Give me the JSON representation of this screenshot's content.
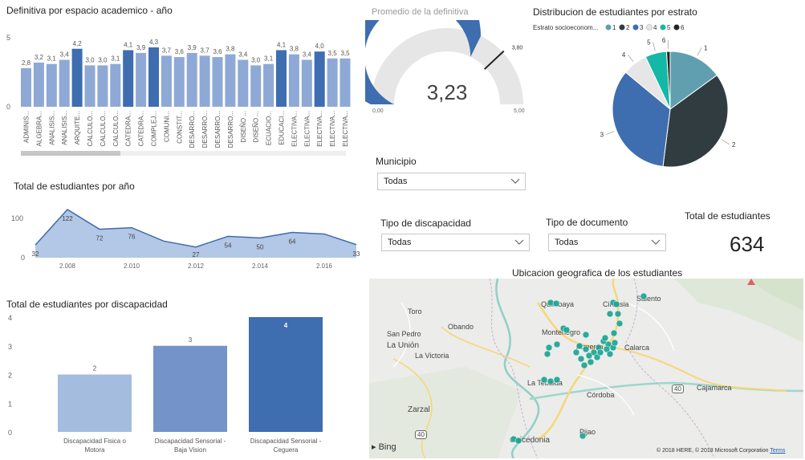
{
  "visual_bar": {
    "title": "Definitiva por espacio academico - año",
    "chart_data": {
      "type": "bar",
      "categories": [
        "ADMINIS...",
        "ALGEBRA...",
        "ANALISIS...",
        "ANALISIS...",
        "ARQUITE...",
        "CALCULO...",
        "CALCULO...",
        "CALCULO...",
        "CATEDRA...",
        "CATEDRA...",
        "COMPLEJ...",
        "COMUNI...",
        "CONSTIT...",
        "DESARRO...",
        "DESARRO...",
        "DESARRO...",
        "DESARRO...",
        "DISEÑO ...",
        "DISEÑO ...",
        "ECUACIO...",
        "EDUCACI...",
        "ELECTIVA...",
        "ELECTIVA...",
        "ELECTIVA...",
        "ELECTIVA...",
        "ELECTIVA..."
      ],
      "values": [
        2.8,
        3.2,
        3.1,
        3.4,
        4.2,
        3.0,
        3.0,
        3.1,
        4.1,
        3.9,
        4.3,
        3.7,
        3.6,
        3.9,
        3.7,
        3.6,
        3.8,
        3.4,
        3.0,
        3.1,
        4.1,
        3.8,
        3.4,
        4.0,
        3.5,
        3.5
      ],
      "value_labels": [
        "2,8",
        "3,2",
        "3,1",
        "3,4",
        "4,2",
        "3,0",
        "3,0",
        "3,1",
        "4,1",
        "3,9",
        "4,3",
        "3,7",
        "3,6",
        "3,9",
        "3,7",
        "3,6",
        "3,8",
        "3,4",
        "3,0",
        "3,1",
        "4,1",
        "3,8",
        "3,4",
        "4,0",
        "3,5",
        "3,5"
      ],
      "ylim": [
        0,
        5
      ],
      "yticks": [
        "0",
        "5"
      ]
    }
  },
  "visual_gauge": {
    "title": "Promedio de la definitiva",
    "chart_data": {
      "type": "gauge",
      "value": 3.23,
      "target": 3.8,
      "min": 0,
      "max": 5
    },
    "value_label": "3,23",
    "min_label": "0,00",
    "max_label": "5,00",
    "target_label": "3,80"
  },
  "visual_pie": {
    "title": "Distribucion de estudiantes por estrato",
    "legend_title": "Estrato socioeconom...",
    "chart_data": {
      "type": "pie",
      "categories": [
        "1",
        "2",
        "3",
        "4",
        "5",
        "6"
      ],
      "values": [
        15,
        37,
        34,
        7,
        6,
        1
      ],
      "colors": [
        "#5F9FB0",
        "#303C40",
        "#3E6DB0",
        "#E6E6E6",
        "#13B8A6",
        "#252423"
      ]
    }
  },
  "visual_area": {
    "title": "Total de estudiantes por año",
    "chart_data": {
      "type": "area",
      "x": [
        2007,
        2008,
        2009,
        2010,
        2011,
        2012,
        2013,
        2014,
        2015,
        2016,
        2017
      ],
      "values": [
        32,
        122,
        72,
        76,
        42,
        27,
        54,
        50,
        64,
        60,
        33
      ],
      "point_labels": [
        "32",
        "122",
        "72",
        "76",
        "",
        "27",
        "54",
        "50",
        "64",
        "",
        "33"
      ],
      "xticks": [
        "2.008",
        "2.010",
        "2.012",
        "2.014",
        "2.016"
      ],
      "xtick_values": [
        2008,
        2010,
        2012,
        2014,
        2016
      ],
      "yticks": [
        "0",
        "100"
      ],
      "ylim": [
        0,
        130
      ]
    }
  },
  "visual_disc": {
    "title": "Total de estudiantes por discapacidad",
    "chart_data": {
      "type": "bar",
      "categories": [
        [
          "Discapacidad Fisica o",
          "Motora"
        ],
        [
          "Discapacidad Sensorial -",
          "Baja Vision"
        ],
        [
          "Discapacidad Sensorial -",
          "Ceguera"
        ]
      ],
      "values": [
        2,
        3,
        4
      ],
      "colors": [
        "#A4BCDD",
        "#7393C9",
        "#3E6DB0"
      ],
      "yticks": [
        "0",
        "1",
        "2",
        "3",
        "4"
      ],
      "ylim": [
        0,
        4
      ]
    }
  },
  "slicers": {
    "municipio": {
      "label": "Municipio",
      "value": "Todas"
    },
    "discapacidad": {
      "label": "Tipo de discapacidad",
      "value": "Todas"
    },
    "documento": {
      "label": "Tipo de documento",
      "value": "Todas"
    }
  },
  "card": {
    "title": "Total de estudiantes",
    "value": "634"
  },
  "map": {
    "title": "Ubicacion geografica de los estudiantes",
    "places": [
      "Quimbaya",
      "Circasia",
      "Salento",
      "Toro",
      "Obando",
      "San Pedro",
      "La Unión",
      "La Victoria",
      "Montenegro",
      "Armenia",
      "Calarca",
      "La Tebaida",
      "Córdoba",
      "Zarzal",
      "Caicedonia",
      "Pijao",
      "Cajamarca"
    ],
    "road_shields": [
      "40",
      "40"
    ],
    "brand": "Bing",
    "attribution": "© 2018 HERE, © 2018 Microsoft Corporation",
    "terms": "Terms"
  },
  "colors": {
    "bar": "#8FA9D6",
    "bar_dark": "#3E6DB0",
    "area_fill": "#B3C7E6",
    "area_line": "#3E6DB0",
    "gauge_fill": "#3E6DB0",
    "gauge_bg": "#E6E6E6"
  }
}
